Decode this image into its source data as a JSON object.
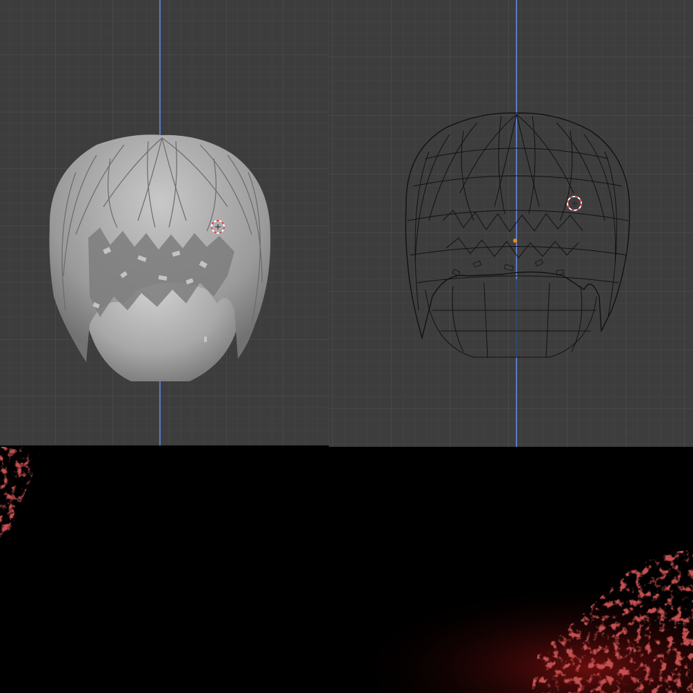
{
  "colors": {
    "viewport_bg": "#3d3d3d",
    "grid_minor": "#474747",
    "grid_major": "#505050",
    "z_axis": "#5a7bc4",
    "solid_shade": "#b4b4b4",
    "wire_edge": "#111111",
    "cursor_red": "#e0434a",
    "cursor_white": "#ffffff",
    "origin_dot": "#e88a1c",
    "texture_bg": "#000000",
    "texture_red": "#8e1414"
  },
  "icons": {
    "cursor_3d": "3d-cursor-icon",
    "origin": "object-origin-icon"
  },
  "layout": {
    "left_view": "solid-shading",
    "right_view": "wireframe-shading",
    "bottom": "hair-texture-map"
  }
}
